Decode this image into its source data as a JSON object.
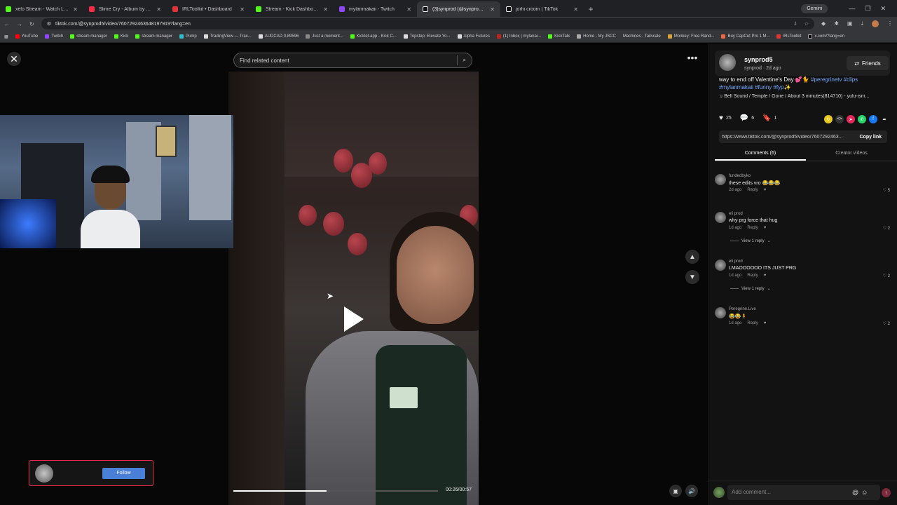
{
  "browser": {
    "tabs": [
      {
        "title": "xelo Stream - Watch Live on Kick",
        "color": "#53fc18"
      },
      {
        "title": "Slime Cry - Album by YoungBoy",
        "color": "#fa2d48"
      },
      {
        "title": "IRLToolkit • Dashboard",
        "color": "#e0343a"
      },
      {
        "title": "Stream - Kick Dashboard",
        "color": "#53fc18"
      },
      {
        "title": "mylanmakaii - Twitch",
        "color": "#9146ff"
      },
      {
        "title": "(3)synprod (@synprod5) | TikTok",
        "color": "#ffffff"
      },
      {
        "title": "jorhi croom | TikTok",
        "color": "#ffffff"
      }
    ],
    "new_tab": "+",
    "gemini": "Gemini",
    "url": "tiktok.com/@synprod5/video/7607292463648197919?lang=en",
    "bookmarks": [
      "YouTube",
      "Twitch",
      "stream manager",
      "Kick",
      "stream manager",
      "Pump",
      "TradingView — Trac...",
      "AUDCAD 0.89596",
      "Just a moment...",
      "Kicklet.app - Kick C...",
      "Topstep: Elevate Yo...",
      "Alpha Futures",
      "(1) Inbox | mylanai...",
      "KickTalk",
      "Home - My JSCC",
      "Machines - Tailscale",
      "Monkey: Free Rand...",
      "Buy CapCut Pro 1 M...",
      "IRLToolkit",
      "x.com/?lang=en"
    ]
  },
  "search": {
    "placeholder": "Find related content"
  },
  "player": {
    "progress": 0.457,
    "time": "00:26/00:57"
  },
  "follow_card": {
    "button": "Follow"
  },
  "author": {
    "name": "synprod5",
    "sub": "synprod · 2d ago",
    "friends_button": "Friends"
  },
  "description": {
    "text": "way to end off Valentine's Day 💕🐈",
    "tags": "#peregrinetv #clips #mylanmakaii #funny #fyp✨",
    "music": "Bell Sound / Temple / Gone / About 3 minutes(814710) - yulu-ism..."
  },
  "stats": {
    "likes": "25",
    "comments": "6",
    "saves": "1"
  },
  "share_link": {
    "url": "https://www.tiktok.com/@synprod5/video/7607292463...",
    "copy": "Copy link"
  },
  "panel_tabs": [
    {
      "label": "Comments (6)"
    },
    {
      "label": "Creator videos"
    }
  ],
  "comments": [
    {
      "user": "fundedbyko",
      "text": "these edits vro 😂😂😂",
      "time": "2d ago",
      "reply": "Reply",
      "likes": "5",
      "view_replies": ""
    },
    {
      "user": "eli prod",
      "text": "why prg force that hug",
      "time": "1d ago",
      "reply": "Reply",
      "likes": "2",
      "view_replies": "View 1 reply"
    },
    {
      "user": "eli prod",
      "text": "LMAOOOOOO ITS JUST PRG",
      "time": "1d ago",
      "reply": "Reply",
      "likes": "2",
      "view_replies": "View 1 reply"
    },
    {
      "user": "Peregrine.Live",
      "text": "😂😂🧍",
      "time": "1d ago",
      "reply": "Reply",
      "likes": "2",
      "view_replies": ""
    }
  ],
  "add_comment": {
    "placeholder": "Add comment..."
  }
}
